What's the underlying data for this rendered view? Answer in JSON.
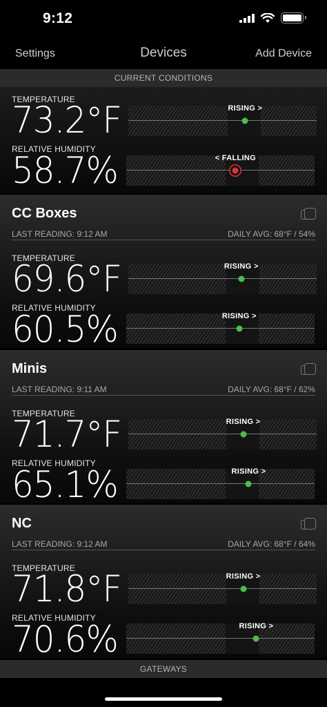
{
  "status": {
    "time": "9:12",
    "icons": [
      "signal-icon",
      "wifi-icon",
      "battery-icon"
    ]
  },
  "nav": {
    "left": "Settings",
    "title": "Devices",
    "right": "Add Device"
  },
  "current": {
    "header": "CURRENT CONDITIONS",
    "temp_label": "TEMPERATURE",
    "temp_value": "73.2°F",
    "temp_trend": "RISING >",
    "temp_trend_pos": 0.62,
    "hum_label": "RELATIVE HUMIDITY",
    "hum_value": "58.7%",
    "hum_trend": "< FALLING",
    "hum_trend_pos": 0.58
  },
  "devices": [
    {
      "name": "CC Boxes",
      "last_reading": "LAST READING: 9:12 AM",
      "daily_avg": "DAILY AVG: 68°F / 54%",
      "temp_label": "TEMPERATURE",
      "temp_value": "69.6°F",
      "temp_trend": "RISING >",
      "temp_trend_pos": 0.6,
      "hum_label": "RELATIVE HUMIDITY",
      "hum_value": "60.5%",
      "hum_trend": "RISING >",
      "hum_trend_pos": 0.6
    },
    {
      "name": "Minis",
      "last_reading": "LAST READING: 9:11 AM",
      "daily_avg": "DAILY AVG: 68°F / 62%",
      "temp_label": "TEMPERATURE",
      "temp_value": "71.7°F",
      "temp_trend": "RISING >",
      "temp_trend_pos": 0.61,
      "hum_label": "RELATIVE HUMIDITY",
      "hum_value": "65.1%",
      "hum_trend": "RISING >",
      "hum_trend_pos": 0.65
    },
    {
      "name": "NC",
      "last_reading": "LAST READING: 9:12 AM",
      "daily_avg": "DAILY AVG: 68°F / 64%",
      "temp_label": "TEMPERATURE",
      "temp_value": "71.8°F",
      "temp_trend": "RISING >",
      "temp_trend_pos": 0.61,
      "hum_label": "RELATIVE HUMIDITY",
      "hum_value": "70.6%",
      "hum_trend": "RISING >",
      "hum_trend_pos": 0.69
    }
  ],
  "footer": {
    "header": "GATEWAYS"
  },
  "colors": {
    "rising": "#4cbd4c",
    "falling": "#e0303b"
  }
}
